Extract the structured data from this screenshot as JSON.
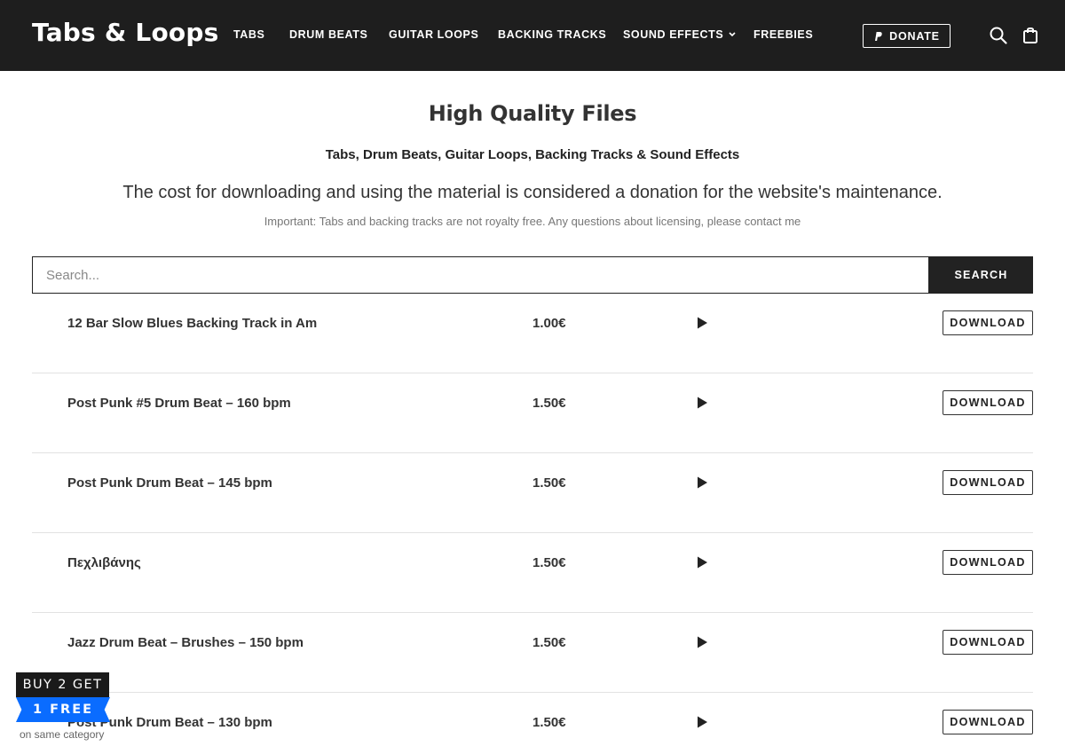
{
  "header": {
    "logo": "Tabs & Loops",
    "nav": [
      {
        "label": "TABS"
      },
      {
        "label": "DRUM BEATS"
      },
      {
        "label": "GUITAR LOOPS"
      },
      {
        "label": "BACKING TRACKS"
      },
      {
        "label": "SOUND EFFECTS",
        "has_dropdown": true
      },
      {
        "label": "FREEBIES"
      }
    ],
    "donate_label": "DONATE",
    "icons": [
      "search-icon",
      "shopping-bag-icon",
      "paypal-icon",
      "chevron-down-icon"
    ]
  },
  "hero": {
    "title": "High Quality Files",
    "subtitle": "Tabs, Drum Beats, Guitar Loops, Backing Tracks & Sound Effects",
    "description": "The cost for downloading and using the material is considered a donation for the website's maintenance.",
    "note": "Important: Tabs and backing tracks are not royalty free. Any questions about licensing, please contact me"
  },
  "search": {
    "placeholder": "Search...",
    "value": "",
    "button_label": "SEARCH"
  },
  "products": [
    {
      "name": "12 Bar Slow Blues Backing Track in Am",
      "price": "1.00€",
      "download_label": "DOWNLOAD"
    },
    {
      "name": "Post Punk #5 Drum Beat – 160 bpm",
      "price": "1.50€",
      "download_label": "DOWNLOAD"
    },
    {
      "name": "Post Punk Drum Beat – 145 bpm",
      "price": "1.50€",
      "download_label": "DOWNLOAD"
    },
    {
      "name": "Πεχλιβάνης",
      "price": "1.50€",
      "download_label": "DOWNLOAD"
    },
    {
      "name": "Jazz Drum Beat – Brushes – 150 bpm",
      "price": "1.50€",
      "download_label": "DOWNLOAD"
    },
    {
      "name": "Post Punk Drum Beat – 130 bpm",
      "price": "1.50€",
      "download_label": "DOWNLOAD"
    }
  ],
  "promo": {
    "line1": "BUY 2 GET",
    "line2": "1 FREE",
    "line3": "on same category"
  },
  "colors": {
    "header_bg": "#1e1e1e",
    "promo_accent": "#0a6cff",
    "button_dark": "#222222"
  }
}
